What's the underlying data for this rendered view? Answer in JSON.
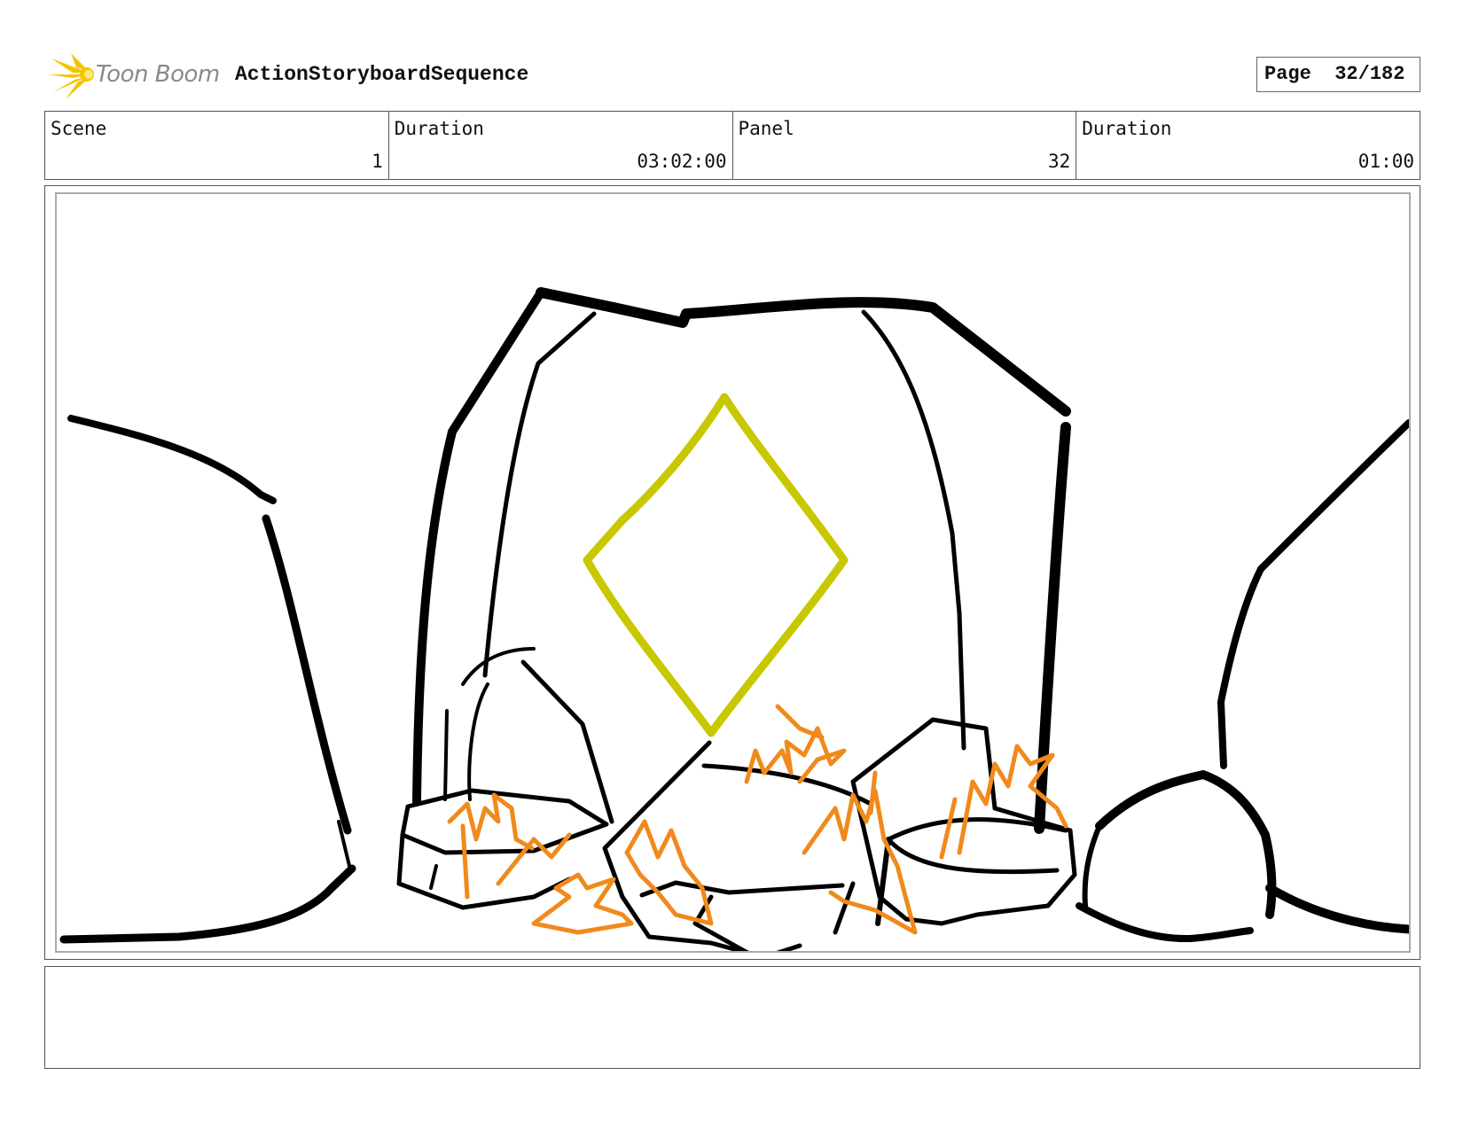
{
  "header": {
    "logo_text": "Toon Boom",
    "sequence_title": "ActionStoryboardSequence",
    "page_label": "Page",
    "page_value": "32/182"
  },
  "info": {
    "scene_label": "Scene",
    "scene_value": "1",
    "scene_duration_label": "Duration",
    "scene_duration_value": "03:02:00",
    "panel_label": "Panel",
    "panel_value": "32",
    "panel_duration_label": "Duration",
    "panel_duration_value": "01:00"
  },
  "notes": {
    "text": ""
  },
  "colors": {
    "sketch_black": "#000000",
    "crystal_yellow": "#c8c800",
    "fire_orange": "#f08a1c",
    "logo_yellow": "#f5c400"
  }
}
